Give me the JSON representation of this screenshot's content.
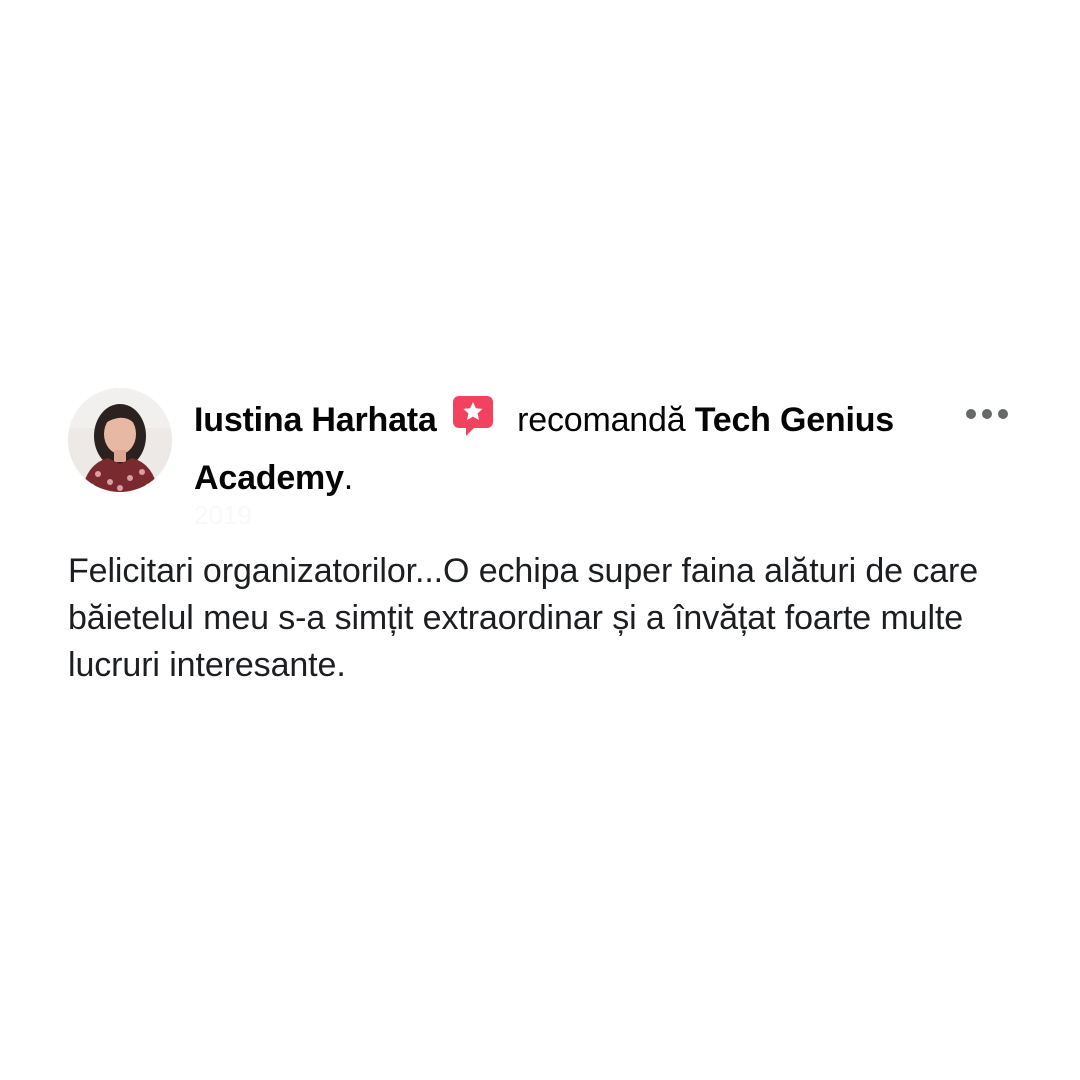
{
  "review": {
    "author_name": "Iustina Harhata",
    "verb": "recomandă",
    "page_name": "Tech Genius Academy",
    "period": ".",
    "timestamp": "2019",
    "text": "Felicitari organizatorilor...O echipa super faina alături de care băietelul meu s-a simțit extraordinar și a învățat foarte multe lucruri interesante."
  },
  "icons": {
    "recommend_badge": "recommend-star-badge-icon",
    "more_menu": "three-dots-more-icon",
    "privacy": "globe-icon"
  },
  "colors": {
    "badge": "#f3425f",
    "text": "#050505",
    "secondary": "#65676b",
    "dots": "#65676b"
  }
}
